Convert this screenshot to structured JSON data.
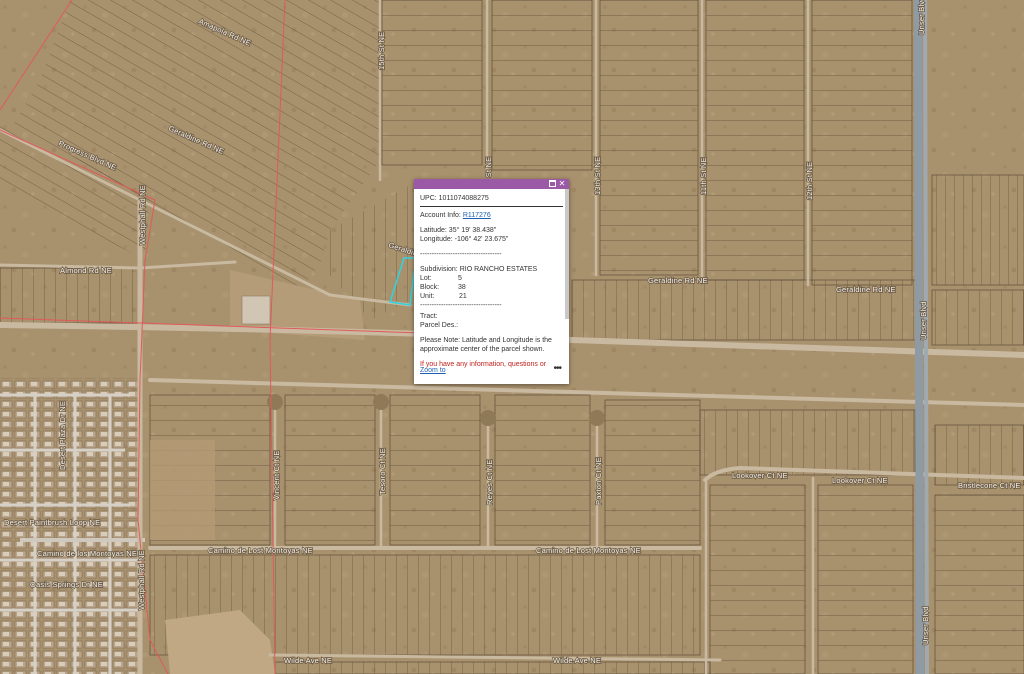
{
  "map": {
    "streets": {
      "amapola": "Amapola Rd NE",
      "geraldine_nw": "Geraldine Rd NE",
      "progress": "Progress Blvd NE",
      "almond": "Almond Rd NE",
      "westphall": "Westphall Rd NE",
      "geraldine_popup": "Geraldine",
      "fifteenth": "15th St NE",
      "fourteenth": "14th St NE",
      "thirteenth": "13th St NE",
      "eleventh": "11th St NE",
      "twelfth": "12th St NE",
      "geraldine_east1": "Geraldine Rd NE",
      "geraldine_east2": "Geraldine Rd NE",
      "unser_top": "Unser Blvd",
      "unser_mid": "Unser Blvd",
      "unser_bottom": "Unser Blvd",
      "desert_plaza": "Desert Plaza Dr NE",
      "desert_paintbrush": "Desert Paintbrush Loop NE",
      "camino_left": "Camino de los Montoyas NE",
      "oasis_springs": "Oasis Springs Dr NE",
      "vincent": "Vincent Ct NE",
      "tesoro": "Tesoro Ct NE",
      "reyes": "Reyes Ct NE",
      "paxton": "Paxton Ct NE",
      "lookover1": "Lookover Ct NE",
      "lookover2": "Lookover Ct NE",
      "bristlecone": "Bristlecone Ct NE",
      "camino_mid1": "Camino de Lost Montoyas NE",
      "camino_mid2": "Camino de Lost Montoyas NE",
      "wilde1": "Wilde Ave NE",
      "wilde2": "Wilde Ave NE",
      "westphall_south": "Westphall Rd NE"
    },
    "colors": {
      "ground": "#a8916d",
      "parcel_line": "#5f4d38",
      "boundary": "#e05a5a",
      "road": "#c8b9a0",
      "highway": "#8e9aa4",
      "highlight": "#2fd4e0"
    }
  },
  "popup": {
    "upc": "UPC: 1011074088275",
    "account_label": "Account Info: ",
    "account_link": "R117276",
    "latitude": "Latitude: 35° 19' 38.438\"",
    "longitude": "Longitude: -106° 42' 23.675\"",
    "divider": "-----------------------------------",
    "subdivision": "Subdivision: RIO RANCHO ESTATES",
    "lot_label": "Lot:",
    "lot_value": "5",
    "block_label": "Block:",
    "block_value": "38",
    "unit_label": "Unit:",
    "unit_value": "21",
    "tract": "Tract:",
    "parcel_des": "Parcel Des.:",
    "note": "Please Note: Latitude and Longitude is the approximate center of the parcel shown.",
    "contact": "If you have any information, questions or",
    "zoom_to": "Zoom to",
    "more": "•••",
    "close_icon": "close-icon",
    "maximize_icon": "maximize-icon"
  }
}
